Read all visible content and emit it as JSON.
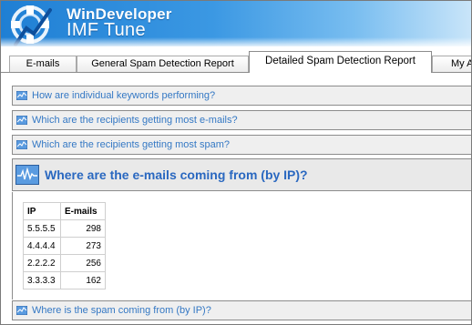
{
  "app": {
    "brand": "WinDeveloper",
    "product": "IMF Tune"
  },
  "tabs": [
    {
      "label": "E-mails",
      "active": false
    },
    {
      "label": "General Spam Detection Report",
      "active": false
    },
    {
      "label": "Detailed Spam Detection Report",
      "active": true
    },
    {
      "label": "My A",
      "active": false
    }
  ],
  "sections": {
    "keywords": "How are individual keywords performing?",
    "recipients_emails": "Which are the recipients getting most e-mails?",
    "recipients_spam": "Which are the recipients getting most spam?",
    "emails_by_ip": "Where are the e-mails coming from (by IP)?",
    "spam_by_ip": "Where is the spam coming from (by IP)?"
  },
  "ip_table": {
    "headers": [
      "IP",
      "E-mails"
    ],
    "rows": [
      [
        "5.5.5.5",
        "298"
      ],
      [
        "4.4.4.4",
        "273"
      ],
      [
        "2.2.2.2",
        "256"
      ],
      [
        "3.3.3.3",
        "162"
      ]
    ]
  },
  "colors": {
    "header_blue": "#1f7fd4",
    "link_blue": "#3478c4",
    "section_bg": "#efefef"
  },
  "icons": {
    "section": "chart-icon",
    "expanded_section": "waveform-chart-icon"
  }
}
